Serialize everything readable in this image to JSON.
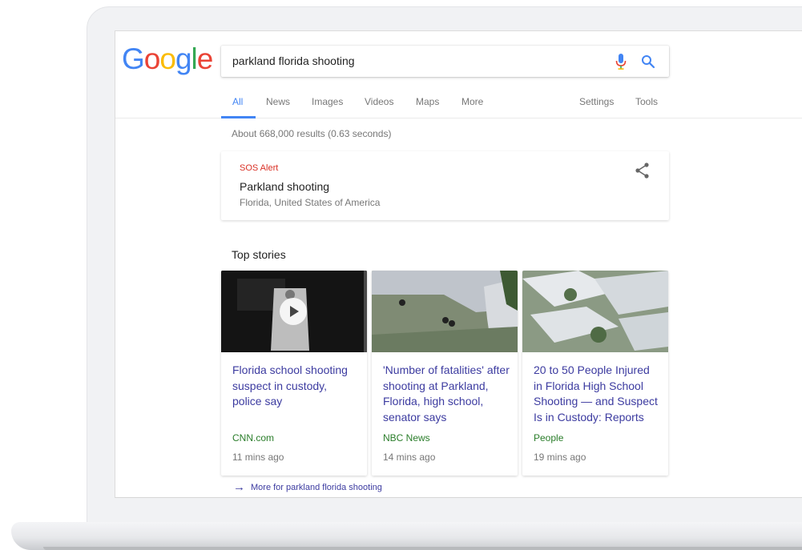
{
  "logo": {
    "text_parts": [
      "G",
      "o",
      "o",
      "g",
      "l",
      "e"
    ]
  },
  "search": {
    "query": "parkland florida shooting"
  },
  "tabs": [
    {
      "label": "All",
      "active": true
    },
    {
      "label": "News"
    },
    {
      "label": "Images"
    },
    {
      "label": "Videos"
    },
    {
      "label": "Maps"
    },
    {
      "label": "More"
    }
  ],
  "tools": {
    "settings": "Settings",
    "tools": "Tools"
  },
  "result_stats": "About 668,000 results (0.63 seconds)",
  "sos": {
    "label": "SOS Alert",
    "title": "Parkland shooting",
    "location": "Florida, United States of America"
  },
  "top_stories": {
    "heading": "Top stories",
    "items": [
      {
        "title": "Florida school shooting suspect in custody, police say",
        "source": "CNN.com",
        "time": "11 mins ago"
      },
      {
        "title": "'Number of fatalities' after shooting at Parkland, Florida, high school, senator says",
        "source": "NBC News",
        "time": "14 mins ago"
      },
      {
        "title": "20 to 50 People Injured in Florida High School Shooting — and Suspect Is in Custody: Reports",
        "source": "People",
        "time": "19 mins ago"
      }
    ],
    "more_link": "More for parkland florida shooting"
  },
  "colors": {
    "accent": "#4285f4",
    "alert": "#d93025",
    "link": "#3c3ba0",
    "source": "#2a7d2a"
  },
  "icons": [
    "mic-icon",
    "search-icon",
    "share-icon",
    "play-icon",
    "arrow-right-icon"
  ]
}
